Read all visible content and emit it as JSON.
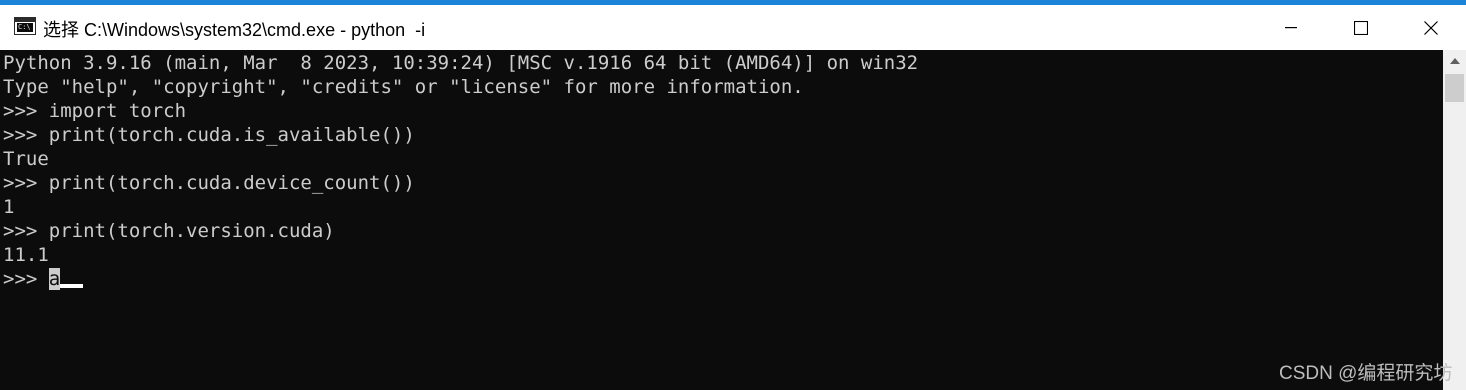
{
  "window": {
    "title": "选择 C:\\Windows\\system32\\cmd.exe - python  -i",
    "icon_text": "C:\\",
    "controls": {
      "minimize": "—",
      "maximize": "☐",
      "close": "✕"
    },
    "accent_color": "#1c84d8"
  },
  "terminal": {
    "lines": [
      "Python 3.9.16 (main, Mar  8 2023, 10:39:24) [MSC v.1916 64 bit (AMD64)] on win32",
      "Type \"help\", \"copyright\", \"credits\" or \"license\" for more information.",
      ">>> import torch",
      ">>> print(torch.cuda.is_available())",
      "True",
      ">>> print(torch.cuda.device_count())",
      "1",
      ">>> print(torch.version.cuda)",
      "11.1"
    ],
    "prompt": ">>> ",
    "selected_input": "a",
    "background": "#0c0c0c",
    "foreground": "#cccccc"
  },
  "scrollbar": {
    "up_arrow": "▲"
  },
  "watermark": "CSDN @编程研究坊"
}
